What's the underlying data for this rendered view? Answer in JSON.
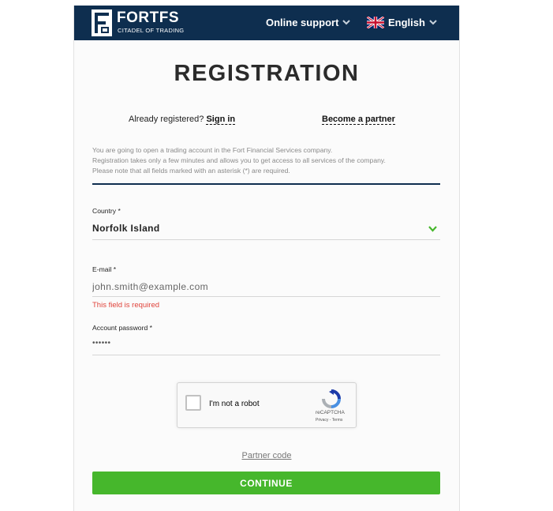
{
  "header": {
    "brand_name": "FORTFS",
    "brand_tagline": "CITADEL OF TRADING",
    "support_label": "Online support",
    "language_label": "English"
  },
  "page": {
    "title": "REGISTRATION",
    "already_registered_text": "Already registered?",
    "sign_in_label": "Sign in",
    "become_partner_label": "Become a partner",
    "intro_lines": [
      "You are going to open a trading account in the Fort Financial Services company.",
      "Registration takes only a few minutes and allows you to get access to all services of the company.",
      "Please note that all fields marked with an asterisk (*) are required."
    ]
  },
  "form": {
    "country_label": "Country *",
    "country_value": "Norfolk Island",
    "email_label": "E-mail *",
    "email_placeholder": "john.smith@example.com",
    "email_error": "This field is required",
    "password_label": "Account password *",
    "password_value": "••••••"
  },
  "recaptcha": {
    "checkbox_label": "I'm not a robot",
    "brand": "reCAPTCHA",
    "terms": "Privacy - Terms"
  },
  "footer": {
    "partner_code_label": "Partner code",
    "continue_label": "CONTINUE"
  },
  "colors": {
    "header_bg": "#0e2e4f",
    "accent_green": "#46b72c",
    "error_red": "#e0433b"
  },
  "icons": {
    "support_chevron": "chevron-down-icon",
    "language_flag": "uk-flag-icon",
    "country_chevron": "chevron-down-icon",
    "recaptcha_logo": "recaptcha-logo-icon"
  }
}
